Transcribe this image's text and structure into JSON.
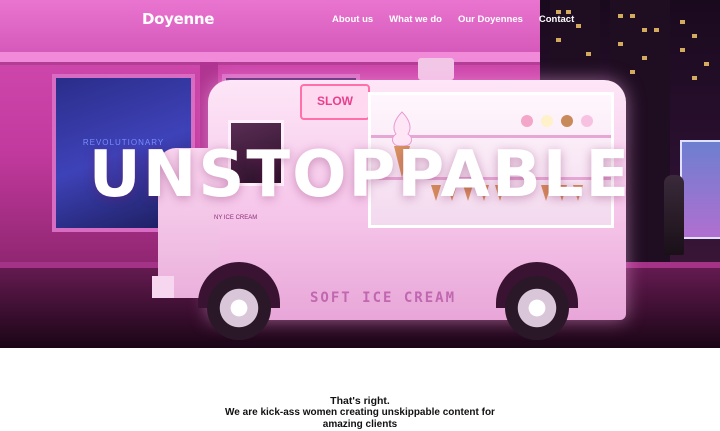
{
  "nav": {
    "logo": "Doyenne",
    "links": [
      "About us",
      "What we do",
      "Our Doyennes",
      "Contact"
    ]
  },
  "hero": {
    "headline": "UNSTOPPABLE",
    "image": {
      "truck_sign": "SLOW",
      "truck_side_text": "SOFT ICE CREAM",
      "truck_door_text": "NY ICE CREAM",
      "poster_text": "REVOLUTIONARY"
    }
  },
  "intro": {
    "title": "That's right.",
    "body": "We are kick-ass women creating unskippable content for amazing clients"
  },
  "colors": {
    "hero_tint": "#c52a93",
    "nav_text": "#ffffff",
    "body_text": "#111111"
  }
}
